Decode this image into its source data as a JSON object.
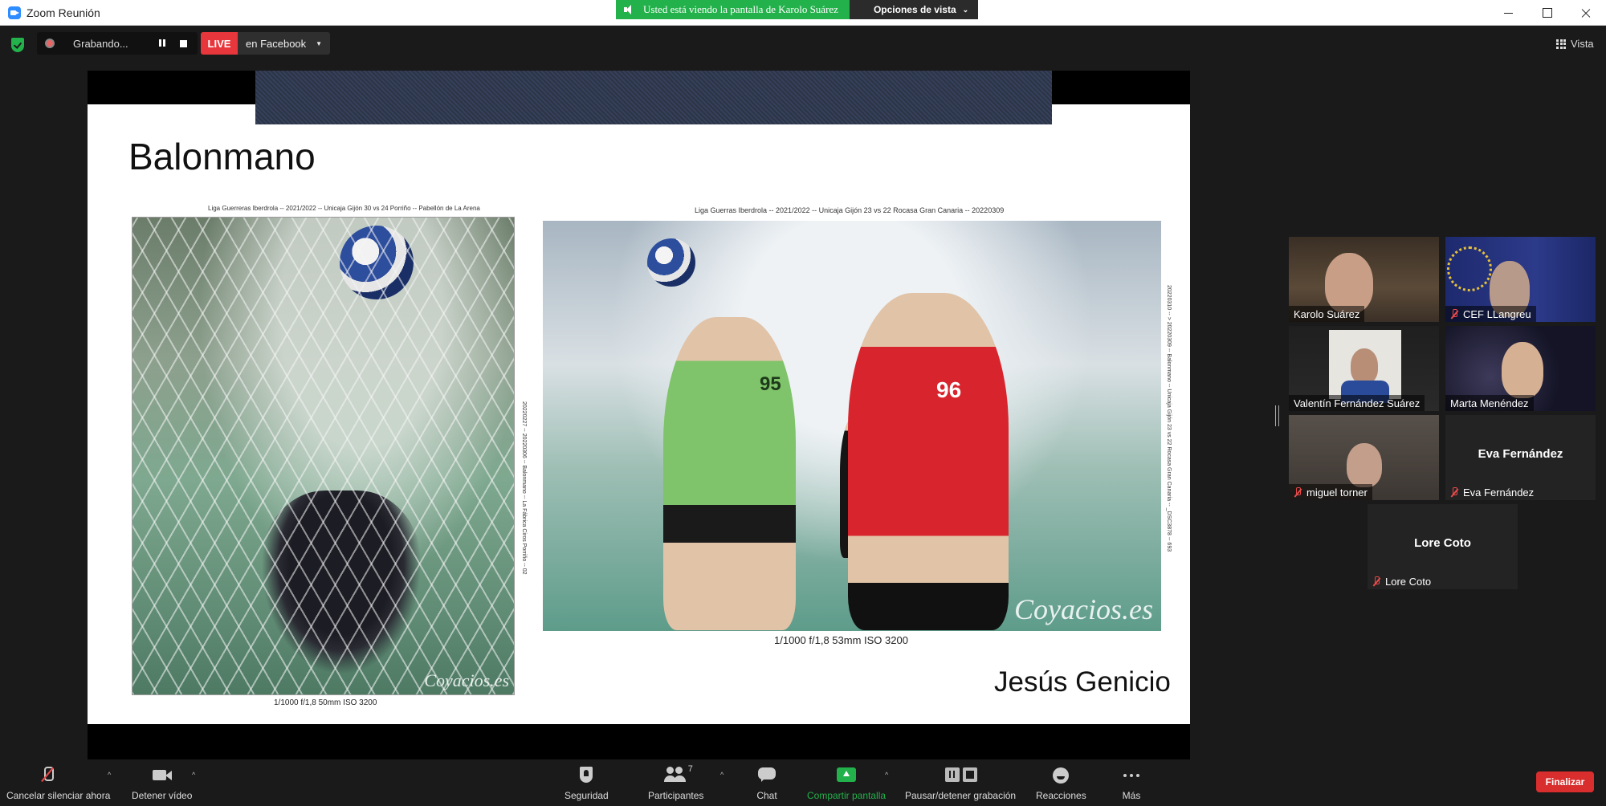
{
  "window": {
    "title": "Zoom Reunión"
  },
  "share_banner": {
    "viewing_text": "Usted está viendo la pantalla de Karolo Suárez",
    "view_options": "Opciones de vista"
  },
  "meeting_bar": {
    "recording_label": "Grabando...",
    "live_label": "LIVE",
    "live_target": "en Facebook",
    "view_label": "Vista"
  },
  "slide": {
    "title": "Balonmano",
    "photo1_top_caption": "Liga Guerreras Iberdrola -- 2021/2022 -- Unicaja Gijón 30 vs 24 Porriño -- Pabellón de La Arena",
    "photo1_bottom_caption": "1/1000 f/1,8 50mm ISO 3200",
    "photo1_watermark": "Coyacios.es",
    "photo1_side_caption": "20220227 -- 20220306 -- Balonmano -- La Fábrica Ciros Porriño -- 02",
    "photo2_top_caption": "Liga Guerras Iberdrola -- 2021/2022 -- Unicaja Gijón 23 vs 22 Rocasa Gran Canaria -- 20220309",
    "photo2_bottom_caption": "1/1000 f/1,8 53mm ISO 3200",
    "photo2_watermark": "Coyacios.es",
    "photo2_side_caption": "20220310 -- > 20220309 -- Balonmano -- Unicaja Gijón 23 vs 22 Rocasa Gran Canaria -- _DSC3878 -- 693",
    "jersey_red": "96",
    "jersey_green": "95",
    "author": "Jesús Genicio"
  },
  "participants": [
    {
      "name": "Karolo Suárez",
      "muted": false,
      "video": true,
      "active": true
    },
    {
      "name": "CEF LLangreu",
      "muted": true,
      "video": true,
      "active": false
    },
    {
      "name": "Valentín Fernández Suárez",
      "muted": false,
      "video": true,
      "active": false
    },
    {
      "name": "Marta Menéndez",
      "muted": false,
      "video": true,
      "active": false
    },
    {
      "name": "miguel torner",
      "muted": true,
      "video": true,
      "active": false
    },
    {
      "name": "Eva Fernández",
      "muted": true,
      "video": false,
      "active": false
    },
    {
      "name": "Lore Coto",
      "muted": true,
      "video": false,
      "active": false
    }
  ],
  "toolbar": {
    "unmute_label": "Cancelar silenciar ahora",
    "video_label": "Detener vídeo",
    "security_label": "Seguridad",
    "participants_label": "Participantes",
    "participants_count": "7",
    "chat_label": "Chat",
    "share_label": "Compartir pantalla",
    "record_label": "Pausar/detener grabación",
    "reactions_label": "Reacciones",
    "more_label": "Más",
    "end_label": "Finalizar"
  },
  "colors": {
    "accent_green": "#23b14b",
    "live_red": "#e8373c",
    "end_red": "#d92e2e",
    "active_speaker": "#d7e57a"
  }
}
